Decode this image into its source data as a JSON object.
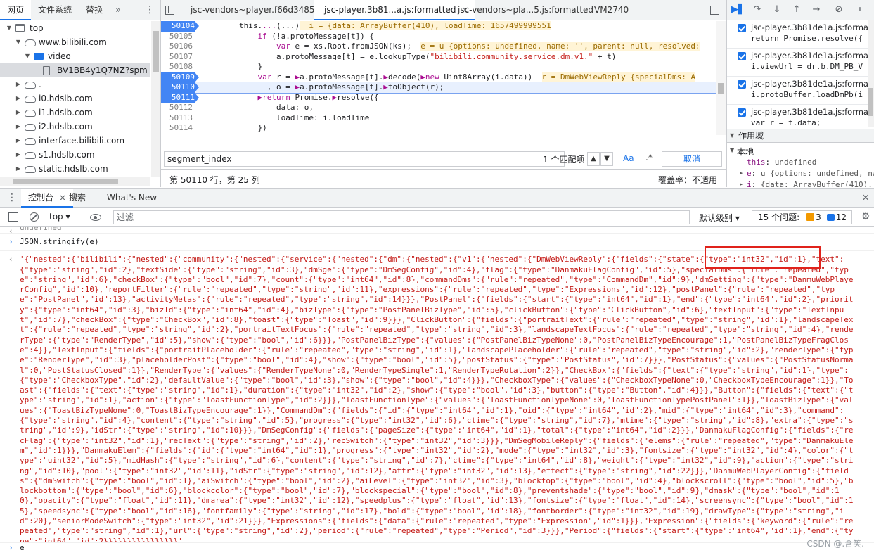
{
  "navigator": {
    "tabs": [
      "网页",
      "文件系统",
      "替换"
    ],
    "more": "»",
    "kebab": "⋮",
    "tree": [
      {
        "label": "top",
        "icon": "frame-icon",
        "expanded": true,
        "indent": 0
      },
      {
        "label": "www.bilibili.com",
        "icon": "cloud-icon",
        "expanded": true,
        "indent": 1
      },
      {
        "label": "video",
        "icon": "folder-icon",
        "expanded": true,
        "indent": 2
      },
      {
        "label": "BV1BB4y1Q7NZ?spm_id_f",
        "icon": "file-icon",
        "expanded": null,
        "indent": 3,
        "selected": true
      },
      {
        "label": ".",
        "icon": "cloud-icon",
        "expanded": false,
        "indent": 1
      },
      {
        "label": "i0.hdslb.com",
        "icon": "cloud-icon",
        "expanded": false,
        "indent": 1
      },
      {
        "label": "i1.hdslb.com",
        "icon": "cloud-icon",
        "expanded": false,
        "indent": 1
      },
      {
        "label": "i2.hdslb.com",
        "icon": "cloud-icon",
        "expanded": false,
        "indent": 1
      },
      {
        "label": "interface.bilibili.com",
        "icon": "cloud-icon",
        "expanded": false,
        "indent": 1
      },
      {
        "label": "s1.hdslb.com",
        "icon": "cloud-icon",
        "expanded": false,
        "indent": 1
      },
      {
        "label": "static.hdslb.com",
        "icon": "cloud-icon",
        "expanded": false,
        "indent": 1
      }
    ]
  },
  "editor": {
    "tabs": [
      {
        "label": "jsc-vendors~player.f66d3485.js",
        "active": false,
        "closable": false
      },
      {
        "label": "jsc-player.3b81...a.js:formatted",
        "active": true,
        "closable": true
      },
      {
        "label": "jsc-vendors~pla...5.js:formatted",
        "active": false,
        "closable": false
      },
      {
        "label": "VM2740",
        "active": false,
        "closable": false
      }
    ],
    "close_glyph": "×",
    "lines": [
      {
        "n": "50104",
        "html": "        this.<span class=\"kw\">...</span>(...)<span class=\"inline-val\">  i = {data: ArrayBuffer(410), loadTime: 1657499999551</span>",
        "bp": true
      },
      {
        "n": "50105",
        "html": "            <span class=\"kw\">if</span> (!a.protoMessage[t]) {"
      },
      {
        "n": "50106",
        "html": "                <span class=\"kw\">var</span> e = xs.Root.fromJSON(ks);  <span class=\"inline-val\">e = u {options: undefined, name: '', parent: null, resolved:</span>"
      },
      {
        "n": "50107",
        "html": "                a.protoMessage[t] = e.lookupType(<span class=\"str\">\"bilibili.community.service.dm.v1.\"</span> + t)"
      },
      {
        "n": "50108",
        "html": "            }"
      },
      {
        "n": "50109",
        "html": "            <span class=\"kw\">var</span> r = <span class=\"kw\">▶</span>a.protoMessage[t].<span class=\"kw\">▶</span>decode(<span class=\"kw\">▶new</span> Uint8Array(i.data))  <span class=\"inline-val\">r = DmWebViewReply {specialDms: A</span>",
        "bp": true
      },
      {
        "n": "50110",
        "html": "              , o = <span class=\"kw\">▶</span>a.protoMessage[t].<span class=\"kw\">▶</span>toObject(r);",
        "bp": true,
        "exec": true
      },
      {
        "n": "50111",
        "html": "            <span class=\"kw\">▶return</span> Promise.<span class=\"kw\">▶</span>resolve({",
        "bp": true
      },
      {
        "n": "50112",
        "html": "                data: o,"
      },
      {
        "n": "50113",
        "html": "                loadTime: i.loadTime"
      },
      {
        "n": "50114",
        "html": "            })"
      },
      {
        "n": "50115",
        "html": "        }"
      }
    ],
    "search": {
      "value": "segment_index",
      "match_count": "1 个匹配项",
      "match_case": "Aa",
      "regex": ".*",
      "cancel": "取消"
    },
    "status": {
      "position": "第 50110 行，第 25 列",
      "coverage": "覆盖率：不适用"
    }
  },
  "debugger": {
    "breakpoints": [
      {
        "file": "jsc-player.3b81de1a.js:format...",
        "src": "return Promise.resolve({"
      },
      {
        "file": "jsc-player.3b81de1a.js:format...",
        "src": "i.viewUrl = dr.b.DM_PB_V"
      },
      {
        "file": "jsc-player.3b81de1a.js:format...",
        "src": "i.protoBuffer.loadDmPb(i"
      },
      {
        "file": "jsc-player.3b81de1a.js:format...",
        "src": "var r = t.data;"
      }
    ],
    "scope_header": "作用域",
    "scope_local": "本地",
    "scope_vars": [
      {
        "name": "this",
        "value": "undefined",
        "expandable": false
      },
      {
        "name": "e",
        "value": "u {options: undefined, na",
        "expandable": true
      },
      {
        "name": "i",
        "value": "{data: ArrayBuffer(410),",
        "expandable": true
      }
    ]
  },
  "drawer": {
    "tabs": [
      {
        "label": "控制台",
        "active": true
      },
      {
        "label": "搜索",
        "active": false
      },
      {
        "label": "What's New",
        "active": false
      }
    ]
  },
  "console_toolbar": {
    "context": "top ▾",
    "filter_placeholder": "过滤",
    "level": "默认级别 ▾",
    "issues_label": "15 个问题:",
    "warn_count": "3",
    "info_count": "12"
  },
  "console": {
    "undefined_text": "undefined",
    "command": "JSON.stringify(e)",
    "result": "'{\"nested\":{\"bilibili\":{\"nested\":{\"community\":{\"nested\":{\"service\":{\"nested\":{\"dm\":{\"nested\":{\"v1\":{\"nested\":{\"DmWebViewReply\":{\"fields\":{\"state\":{\"type\":\"int32\",\"id\":1},\"text\":{\"type\":\"string\",\"id\":2},\"textSide\":{\"type\":\"string\",\"id\":3},\"dmSge\":{\"type\":\"DmSegConfig\",\"id\":4},\"flag\":{\"type\":\"DanmakuFlagConfig\",\"id\":5},\"specialDms\":{\"rule\":\"repeated\",\"type\":\"string\",\"id\":6},\"checkBox\":{\"type\":\"bool\",\"id\":7},\"count\":{\"type\":\"int64\",\"id\":8},\"commandDms\":{\"rule\":\"repeated\",\"type\":\"CommandDm\",\"id\":9},\"dmSetting\":{\"type\":\"DanmuWebPlayerConfig\",\"id\":10},\"reportFilter\":{\"rule\":\"repeated\",\"type\":\"string\",\"id\":11},\"expressions\":{\"rule\":\"repeated\",\"type\":\"Expressions\",\"id\":12},\"postPanel\":{\"rule\":\"repeated\",\"type\":\"PostPanel\",\"id\":13},\"activityMetas\":{\"rule\":\"repeated\",\"type\":\"string\",\"id\":14}}},\"PostPanel\":{\"fields\":{\"start\":{\"type\":\"int64\",\"id\":1},\"end\":{\"type\":\"int64\",\"id\":2},\"priority\":{\"type\":\"int64\",\"id\":3},\"bizId\":{\"type\":\"int64\",\"id\":4},\"bizType\":{\"type\":\"PostPanelBizType\",\"id\":5},\"clickButton\":{\"type\":\"ClickButton\",\"id\":6},\"textInput\":{\"type\":\"TextInput\",\"id\":7},\"checkBox\":{\"type\":\"CheckBox\",\"id\":8},\"toast\":{\"type\":\"Toast\",\"id\":9}}},\"ClickButton\":{\"fields\":{\"portraitText\":{\"rule\":\"repeated\",\"type\":\"string\",\"id\":1},\"landscapeText\":{\"rule\":\"repeated\",\"type\":\"string\",\"id\":2},\"portraitTextFocus\":{\"rule\":\"repeated\",\"type\":\"string\",\"id\":3},\"landscapeTextFocus\":{\"rule\":\"repeated\",\"type\":\"string\",\"id\":4},\"renderType\":{\"type\":\"RenderType\",\"id\":5},\"show\":{\"type\":\"bool\",\"id\":6}}},\"PostPanelBizType\":{\"values\":{\"PostPanelBizTypeNone\":0,\"PostPanelBizTypeEncourage\":1,\"PostPanelBizTypeFragClose\":4}},\"TextInput\":{\"fields\":{\"portraitPlaceholder\":{\"rule\":\"repeated\",\"type\":\"string\",\"id\":1},\"landscapePlaceholder\":{\"rule\":\"repeated\",\"type\":\"string\",\"id\":2},\"renderType\":{\"type\":\"RenderType\",\"id\":3},\"placeholderPost\":{\"type\":\"bool\",\"id\":4},\"show\":{\"type\":\"bool\",\"id\":5},\"postStatus\":{\"type\":\"PostStatus\",\"id\":7}}},\"PostStatus\":{\"values\":{\"PostStatusNormal\":0,\"PostStatusClosed\":1}},\"RenderType\":{\"values\":{\"RenderTypeNone\":0,\"RenderTypeSingle\":1,\"RenderTypeRotation\":2}},\"CheckBox\":{\"fields\":{\"text\":{\"type\":\"string\",\"id\":1},\"type\":{\"type\":\"CheckboxType\",\"id\":2},\"defaultValue\":{\"type\":\"bool\",\"id\":3},\"show\":{\"type\":\"bool\",\"id\":4}}},\"CheckboxType\":{\"values\":{\"CheckboxTypeNone\":0,\"CheckboxTypeEncourage\":1}},\"Toast\":{\"fields\":{\"text\":{\"type\":\"string\",\"id\":1},\"duration\":{\"type\":\"int32\",\"id\":2},\"show\":{\"type\":\"bool\",\"id\":3},\"button\":{\"type\":\"Button\",\"id\":4}}},\"Button\":{\"fields\":{\"text\":{\"type\":\"string\",\"id\":1},\"action\":{\"type\":\"ToastFunctionType\",\"id\":2}}},\"ToastFunctionType\":{\"values\":{\"ToastFunctionTypeNone\":0,\"ToastFunctionTypePostPanel\":1}},\"ToastBizType\":{\"values\":{\"ToastBizTypeNone\":0,\"ToastBizTypeEncourage\":1}},\"CommandDm\":{\"fields\":{\"id\":{\"type\":\"int64\",\"id\":1},\"oid\":{\"type\":\"int64\",\"id\":2},\"mid\":{\"type\":\"int64\",\"id\":3},\"command\":{\"type\":\"string\",\"id\":4},\"content\":{\"type\":\"string\",\"id\":5},\"progress\":{\"type\":\"int32\",\"id\":6},\"ctime\":{\"type\":\"string\",\"id\":7},\"mtime\":{\"type\":\"string\",\"id\":8},\"extra\":{\"type\":\"string\",\"id\":9},\"idStr\":{\"type\":\"string\",\"id\":10}}},\"DmSegConfig\":{\"fields\":{\"pageSize\":{\"type\":\"int64\",\"id\":1},\"total\":{\"type\":\"int64\",\"id\":2}}},\"DanmakuFlagConfig\":{\"fields\":{\"recFlag\":{\"type\":\"int32\",\"id\":1},\"recText\":{\"type\":\"string\",\"id\":2},\"recSwitch\":{\"type\":\"int32\",\"id\":3}}},\"DmSegMobileReply\":{\"fields\":{\"elems\":{\"rule\":\"repeated\",\"type\":\"DanmakuElem\",\"id\":1}}},\"DanmakuElem\":{\"fields\":{\"id\":{\"type\":\"int64\",\"id\":1},\"progress\":{\"type\":\"int32\",\"id\":2},\"mode\":{\"type\":\"int32\",\"id\":3},\"fontsize\":{\"type\":\"int32\",\"id\":4},\"color\":{\"type\":\"uint32\",\"id\":5},\"midHash\":{\"type\":\"string\",\"id\":6},\"content\":{\"type\":\"string\",\"id\":7},\"ctime\":{\"type\":\"int64\",\"id\":8},\"weight\":{\"type\":\"int32\",\"id\":9},\"action\":{\"type\":\"string\",\"id\":10},\"pool\":{\"type\":\"int32\",\"id\":11},\"idStr\":{\"type\":\"string\",\"id\":12},\"attr\":{\"type\":\"int32\",\"id\":13},\"effect\":{\"type\":\"string\",\"id\":22}}},\"DanmuWebPlayerConfig\":{\"fields\":{\"dmSwitch\":{\"type\":\"bool\",\"id\":1},\"aiSwitch\":{\"type\":\"bool\",\"id\":2},\"aiLevel\":{\"type\":\"int32\",\"id\":3},\"blocktop\":{\"type\":\"bool\",\"id\":4},\"blockscroll\":{\"type\":\"bool\",\"id\":5},\"blockbottom\":{\"type\":\"bool\",\"id\":6},\"blockcolor\":{\"type\":\"bool\",\"id\":7},\"blockspecial\":{\"type\":\"bool\",\"id\":8},\"preventshade\":{\"type\":\"bool\",\"id\":9},\"dmask\":{\"type\":\"bool\",\"id\":10},\"opacity\":{\"type\":\"float\",\"id\":11},\"dmarea\":{\"type\":\"int32\",\"id\":12},\"speedplus\":{\"type\":\"float\",\"id\":13},\"fontsize\":{\"type\":\"float\",\"id\":14},\"screensync\":{\"type\":\"bool\",\"id\":15},\"speedsync\":{\"type\":\"bool\",\"id\":16},\"fontfamily\":{\"type\":\"string\",\"id\":17},\"bold\":{\"type\":\"bool\",\"id\":18},\"fontborder\":{\"type\":\"int32\",\"id\":19},\"drawType\":{\"type\":\"string\",\"id\":20},\"seniorModeSwitch\":{\"type\":\"int32\",\"id\":21}}},\"Expressions\":{\"fields\":{\"data\":{\"rule\":\"repeated\",\"type\":\"Expression\",\"id\":1}}},\"Expression\":{\"fields\":{\"keyword\":{\"rule\":\"repeated\",\"type\":\"string\",\"id\":1},\"url\":{\"type\":\"string\",\"id\":2},\"period\":{\"rule\":\"repeated\",\"type\":\"Period\",\"id\":3}}},\"Period\":{\"fields\":{\"start\":{\"type\":\"int64\",\"id\":1},\"end\":{\"type\":\"int64\",\"id\":2}}}}}}}}}}}}}}}}'",
    "prompt": "e"
  },
  "watermark": "CSDN @.含笑.",
  "colors": {
    "accent": "#1a73e8",
    "highlight_box": "#e0221b",
    "string": "#c41a16"
  }
}
